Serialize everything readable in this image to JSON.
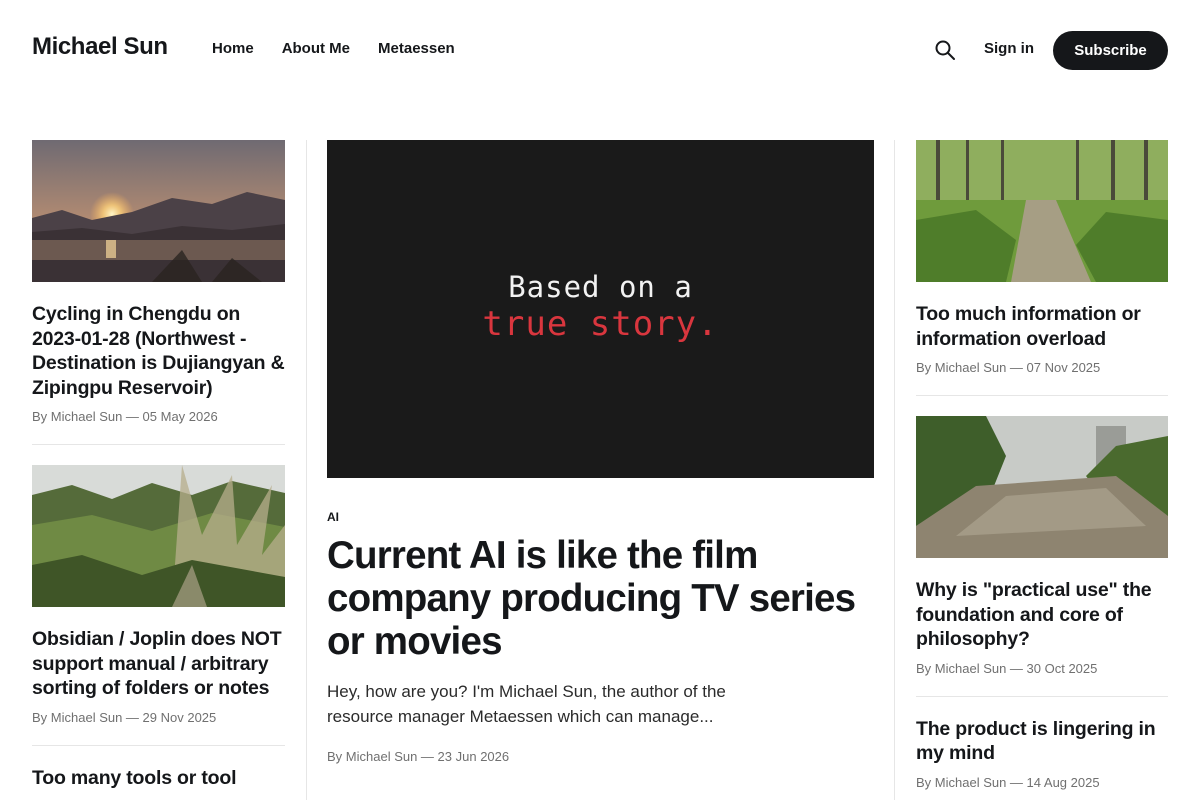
{
  "site": {
    "title": "Michael Sun"
  },
  "nav": {
    "items": [
      "Home",
      "About Me",
      "Metaessen"
    ]
  },
  "header": {
    "sign_in": "Sign in",
    "subscribe": "Subscribe",
    "search_icon": "search-icon"
  },
  "left_posts": [
    {
      "title": "Cycling in Chengdu on 2023-01-28 (Northwest - Destination is Dujiangyan & Zipingpu Reservoir)",
      "meta": "By Michael Sun — 05 May 2026"
    },
    {
      "title": "Obsidian / Joplin does NOT support manual / arbitrary sorting of folders or notes",
      "meta": "By Michael Sun — 29 Nov 2025"
    },
    {
      "title": "Too many tools or tool"
    }
  ],
  "feature": {
    "image_text_line1": "Based on a",
    "image_text_line2": "true story.",
    "tag": "AI",
    "title": "Current AI is like the film company producing TV series or movies",
    "excerpt": "Hey, how are you? I'm Michael Sun, the author of the resource manager Metaessen which can manage...",
    "meta": "By Michael Sun — 23 Jun 2026"
  },
  "right_posts": [
    {
      "title": "Too much information or information overload",
      "meta": "By Michael Sun — 07 Nov 2025"
    },
    {
      "title": "Why is \"practical use\" the foundation and core of philosophy?",
      "meta": "By Michael Sun — 30 Oct 2025"
    },
    {
      "title": "The product is lingering in my mind",
      "meta": "By Michael Sun — 14 Aug 2025"
    }
  ],
  "colors": {
    "brand_dark": "#15171a",
    "meta_gray": "#707070",
    "divider": "#e6e6e6",
    "accent_red": "#d9363e"
  }
}
